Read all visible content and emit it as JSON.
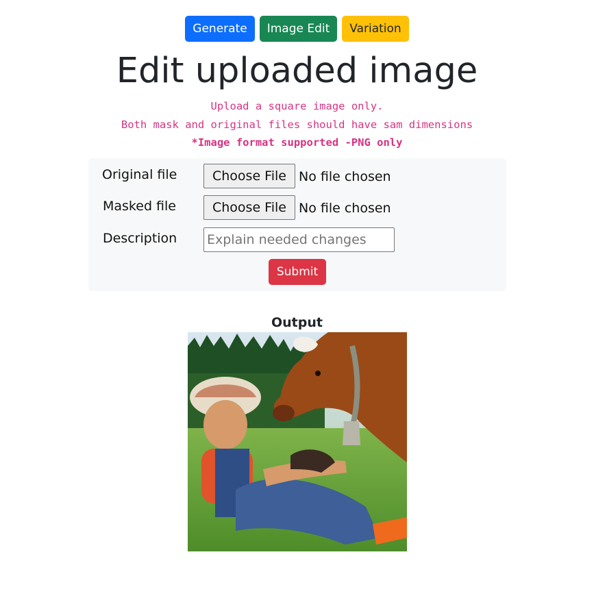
{
  "colors": {
    "primary": "#0d6efd",
    "success": "#198754",
    "warning": "#ffc107",
    "danger": "#dc3545",
    "code": "#d63384"
  },
  "nav": {
    "generate": "Generate",
    "image_edit": "Image Edit",
    "variation": "Variation"
  },
  "page_title": "Edit uploaded image",
  "notes": {
    "line1": "Upload a square image only.",
    "line2": "Both mask and original files should have sam dimensions",
    "line3": "*Image format supported -PNG only"
  },
  "form": {
    "original_label": "Original file",
    "original_button": "Choose File",
    "original_status": "No file chosen",
    "masked_label": "Masked file",
    "masked_button": "Choose File",
    "masked_status": "No file chosen",
    "description_label": "Description",
    "description_value": "",
    "description_placeholder": "Explain needed changes",
    "submit_label": "Submit"
  },
  "output": {
    "label": "Output",
    "image_icon": "photo-boy-with-cow-icon"
  }
}
